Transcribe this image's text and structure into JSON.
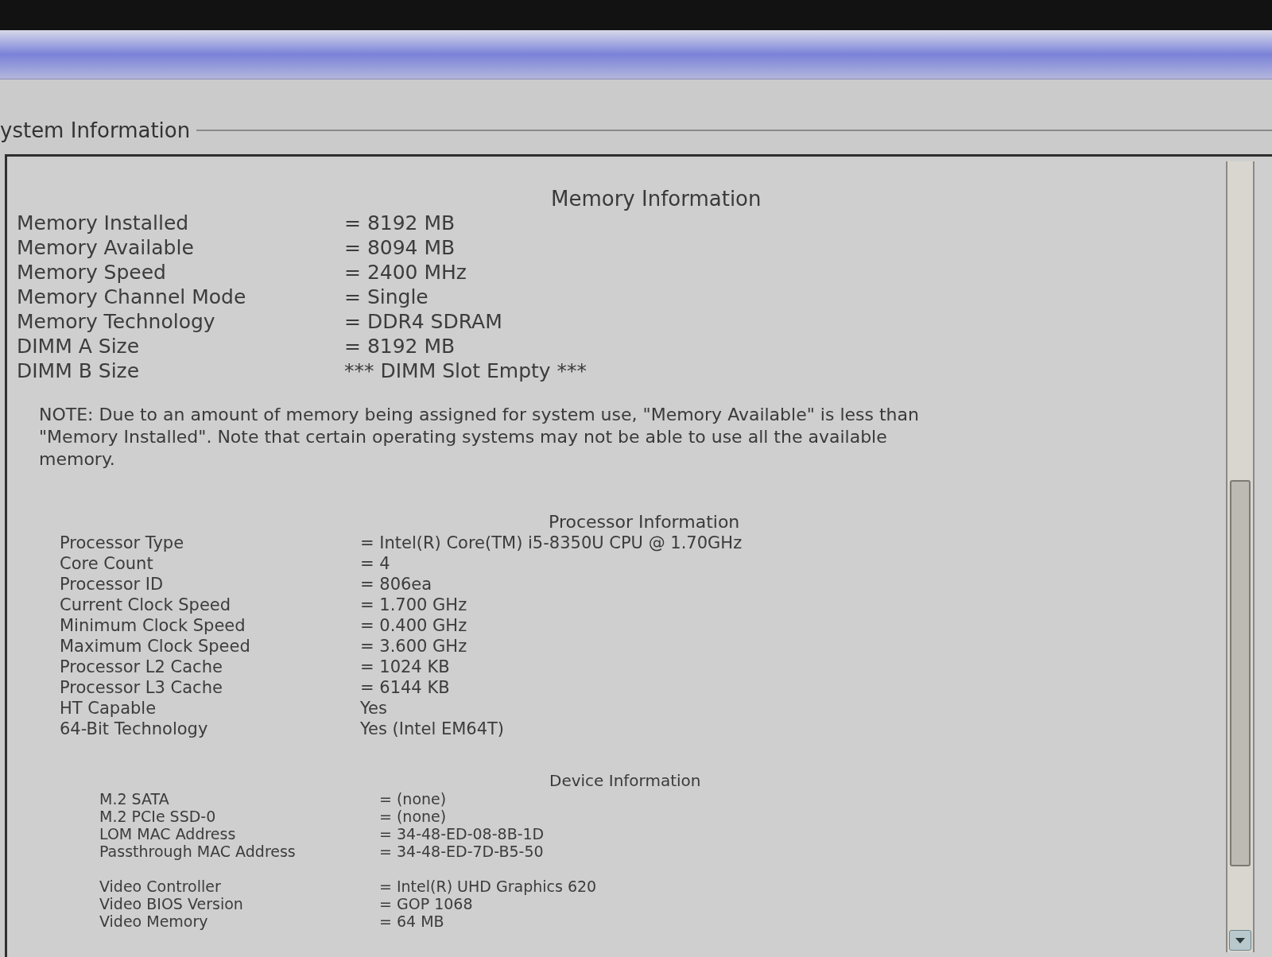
{
  "group_box": {
    "title": "ystem Information"
  },
  "sections": [
    {
      "heading": "Memory Information",
      "groups": [
        [
          {
            "label": "Memory Installed",
            "value": "= 8192 MB"
          },
          {
            "label": "Memory Available",
            "value": "= 8094 MB"
          },
          {
            "label": "Memory Speed",
            "value": "= 2400 MHz"
          },
          {
            "label": "Memory Channel Mode",
            "value": "= Single"
          },
          {
            "label": "Memory Technology",
            "value": "= DDR4 SDRAM"
          },
          {
            "label": "DIMM A Size",
            "value": "= 8192 MB"
          },
          {
            "label": "DIMM B Size",
            "value": "*** DIMM Slot Empty ***"
          }
        ]
      ],
      "note": "NOTE: Due to an amount of memory being assigned for system use, \"Memory Available\" is less than \"Memory Installed\". Note that certain operating systems may not be able to use all the available memory."
    },
    {
      "heading": "Processor Information",
      "groups": [
        [
          {
            "label": "Processor Type",
            "value": "= Intel(R) Core(TM) i5-8350U CPU @ 1.70GHz"
          },
          {
            "label": "Core Count",
            "value": "= 4"
          },
          {
            "label": "Processor ID",
            "value": "= 806ea"
          },
          {
            "label": "Current Clock Speed",
            "value": "= 1.700 GHz"
          },
          {
            "label": "Minimum Clock Speed",
            "value": "= 0.400 GHz"
          },
          {
            "label": "Maximum Clock Speed",
            "value": "= 3.600 GHz"
          },
          {
            "label": "Processor L2 Cache",
            "value": "= 1024 KB"
          },
          {
            "label": "Processor L3 Cache",
            "value": "= 6144 KB"
          },
          {
            "label": "HT Capable",
            "value": "Yes"
          },
          {
            "label": "64-Bit Technology",
            "value": "Yes (Intel EM64T)"
          }
        ]
      ]
    },
    {
      "heading": "Device Information",
      "groups": [
        [
          {
            "label": "M.2 SATA",
            "value": "= (none)"
          },
          {
            "label": "M.2 PCIe SSD-0",
            "value": "= (none)"
          },
          {
            "label": "LOM MAC Address",
            "value": "= 34-48-ED-08-8B-1D"
          },
          {
            "label": "Passthrough MAC Address",
            "value": "= 34-48-ED-7D-B5-50"
          }
        ],
        [
          {
            "label": "Video Controller",
            "value": "= Intel(R) UHD Graphics 620"
          },
          {
            "label": "Video BIOS Version",
            "value": "= GOP 1068"
          },
          {
            "label": "Video Memory",
            "value": "= 64 MB"
          }
        ]
      ]
    }
  ]
}
